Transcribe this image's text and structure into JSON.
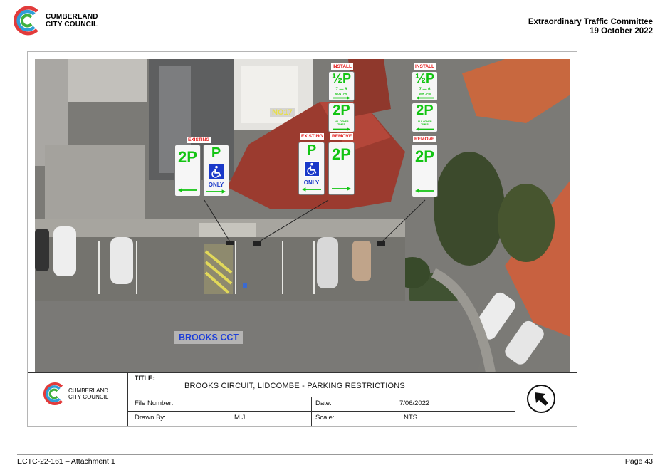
{
  "header": {
    "logo_line1": "CUMBERLAND",
    "logo_line2": "CITY COUNCIL",
    "committee": "Extraordinary Traffic Committee",
    "date": "19 October 2022"
  },
  "map": {
    "property_label": "NO17",
    "street_label": "BROOKS CCT",
    "signs": {
      "existing_tag": "EXISTING",
      "remove_tag": "REMOVE",
      "install_tag": "INSTALL",
      "two_p": "2P",
      "p": "P",
      "half_p": "½P",
      "only": "ONLY",
      "half_p_hours": "7 — 6",
      "half_p_days": "MON - FRI",
      "all_other_line1": "ALL OTHER",
      "all_other_line2": "TIMES"
    }
  },
  "title_block": {
    "logo_line1": "CUMBERLAND",
    "logo_line2": "CITY COUNCIL",
    "title_label": "TITLE:",
    "title": "BROOKS CIRCUIT, LIDCOMBE - PARKING RESTRICTIONS",
    "file_number_label": "File Number:",
    "file_number": "",
    "date_label": "Date:",
    "date": "7/06/2022",
    "drawn_by_label": "Drawn By:",
    "drawn_by": "M J",
    "scale_label": "Scale:",
    "scale": "NTS",
    "north_icon": "north-arrow-icon"
  },
  "footer": {
    "reference": "ECTC-22-161 – Attachment 1",
    "page": "Page 43"
  }
}
